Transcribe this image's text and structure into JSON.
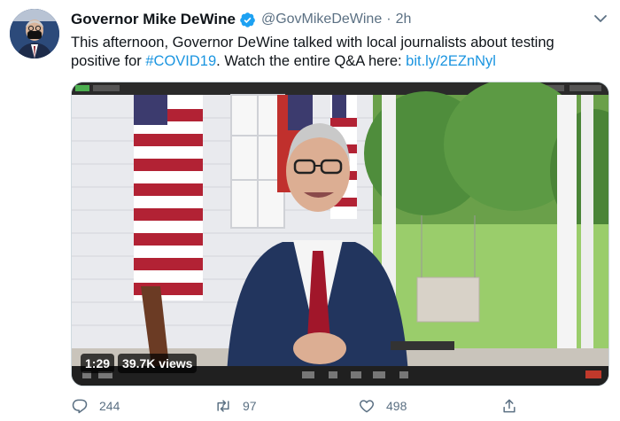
{
  "tweet": {
    "author": {
      "name": "Governor Mike DeWine",
      "handle": "@GovMikeDeWine",
      "separator": "·",
      "time": "2h"
    },
    "text": {
      "part1": "This afternoon, Governor DeWine talked with local journalists about testing positive for ",
      "hashtag": "#COVID19",
      "part2": ". Watch the entire Q&A here: ",
      "link": "bit.ly/2EZnNyl"
    },
    "video": {
      "duration": "1:29",
      "views": "39.7K views"
    },
    "stats": {
      "replies": "244",
      "retweets": "97",
      "likes": "498"
    }
  },
  "colors": {
    "link": "#1b95e0",
    "secondary_text": "#5b7083",
    "verified": "#1da1f2"
  }
}
